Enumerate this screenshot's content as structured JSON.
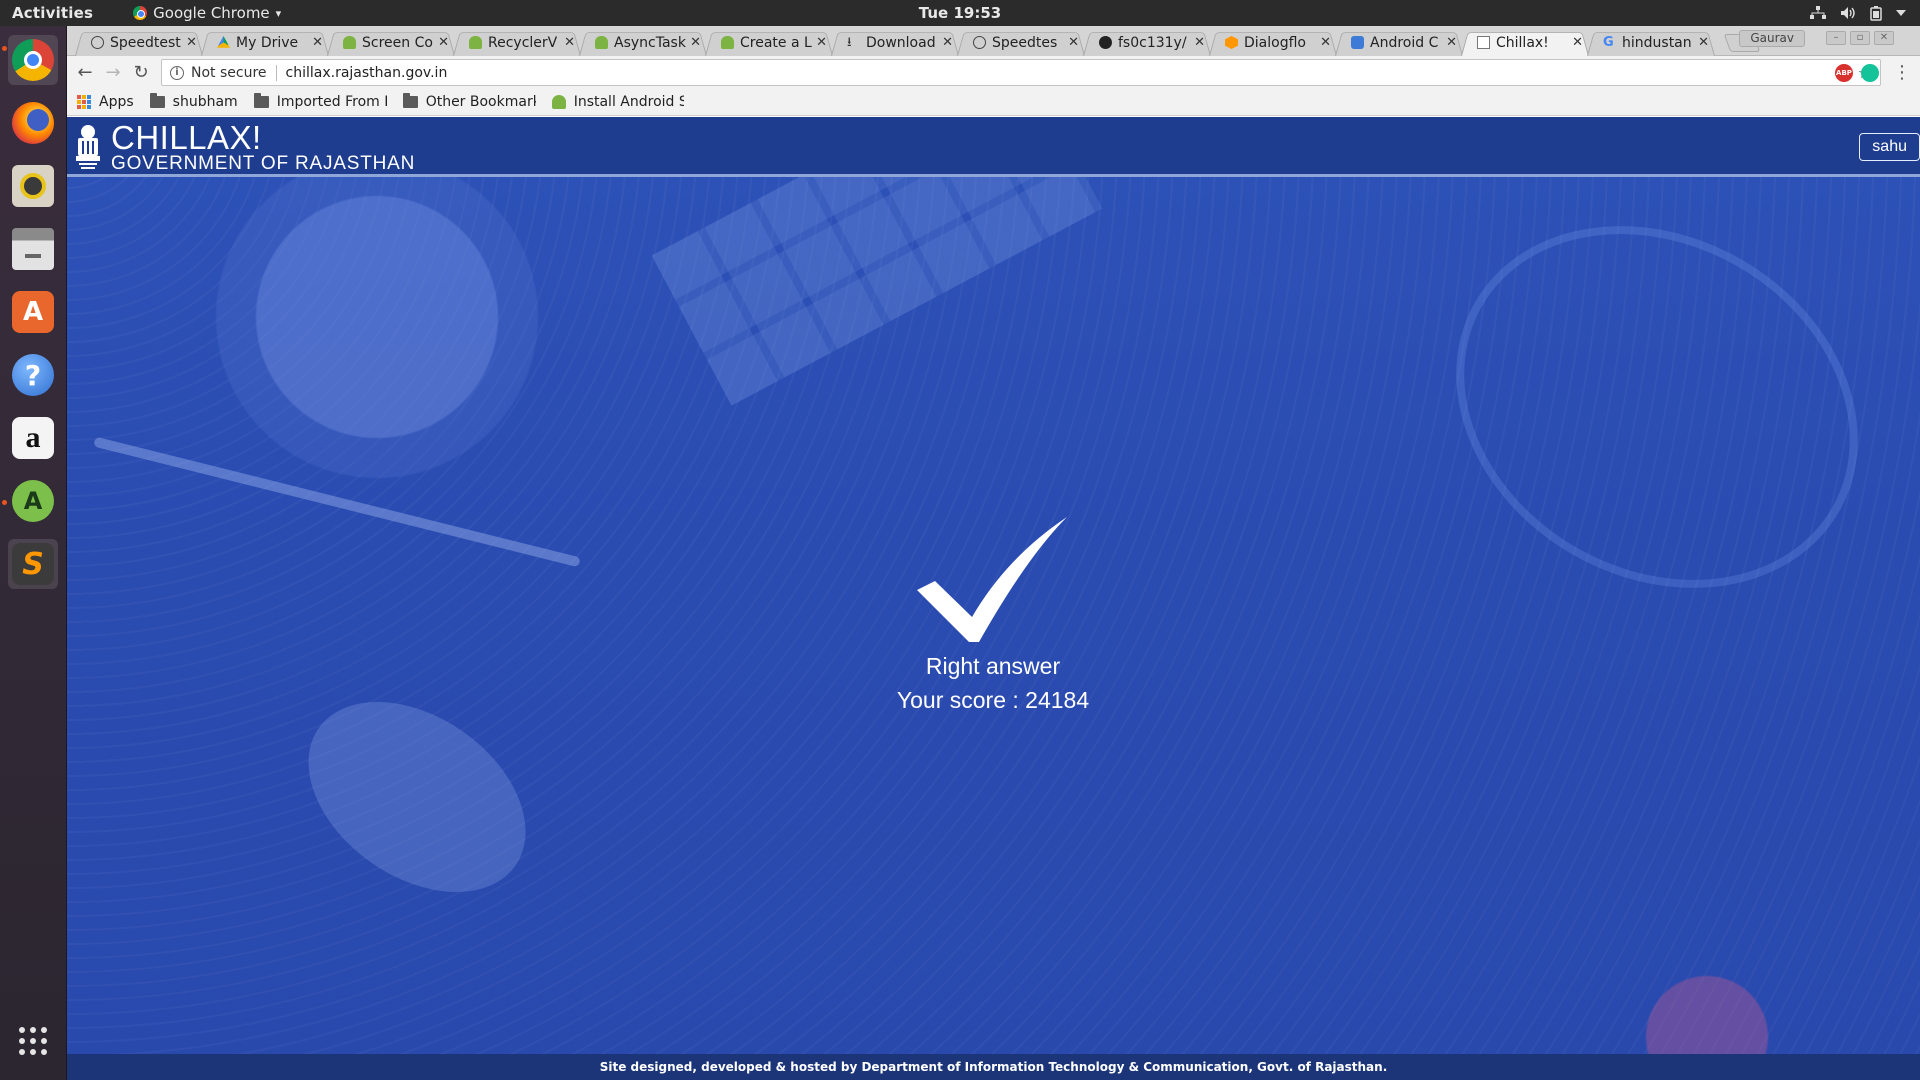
{
  "topbar": {
    "activities": "Activities",
    "app_name": "Google Chrome",
    "app_caret": "▾",
    "clock": "Tue 19:53",
    "tray_icons": [
      "network-icon",
      "volume-icon",
      "battery-icon",
      "power-menu-icon"
    ]
  },
  "dock": {
    "items": [
      "chrome-icon",
      "firefox-icon",
      "rhythmbox-icon",
      "files-icon",
      "software-center-icon",
      "help-icon",
      "amazon-icon",
      "android-studio-icon",
      "sublime-text-icon"
    ],
    "show_apps": "app-grid-icon"
  },
  "tabs": [
    {
      "title": "Speedtest",
      "icon": "speedometer-icon"
    },
    {
      "title": "My Drive",
      "icon": "drive-icon"
    },
    {
      "title": "Screen Co",
      "icon": "android-icon"
    },
    {
      "title": "RecyclerV",
      "icon": "android-icon"
    },
    {
      "title": "AsyncTask",
      "icon": "android-icon"
    },
    {
      "title": "Create a L",
      "icon": "android-icon"
    },
    {
      "title": "Download",
      "icon": "download-icon"
    },
    {
      "title": "Speedtes",
      "icon": "speedometer-icon"
    },
    {
      "title": "fs0c131y/",
      "icon": "github-icon"
    },
    {
      "title": "Dialogflo",
      "icon": "dialogflow-icon"
    },
    {
      "title": "Android C",
      "icon": "puzzle-icon"
    },
    {
      "title": "Chillax!",
      "icon": "page-icon",
      "active": true
    },
    {
      "title": "hindustan",
      "icon": "google-icon"
    }
  ],
  "profile_name": "Gaurav",
  "omnibox": {
    "security": "Not secure",
    "url": "chillax.rajasthan.gov.in"
  },
  "bookmarks": {
    "apps": "Apps",
    "items": [
      "shubham",
      "Imported From F",
      "Other Bookmark",
      "Install Android S"
    ]
  },
  "site": {
    "title": "CHILLAX!",
    "subtitle": "GOVERNMENT OF RAJASTHAN",
    "user": "sahu",
    "result_label": "Right answer",
    "score_text": "Your score : 24184",
    "footer": "Site designed, developed & hosted by Department of Information Technology & Communication, Govt. of Rajasthan."
  },
  "colors": {
    "header_bg": "#1f3d8f",
    "page_bg": "#2b4fb3",
    "footer_bg": "#1b3578",
    "ubuntu_orange": "#e95420"
  }
}
